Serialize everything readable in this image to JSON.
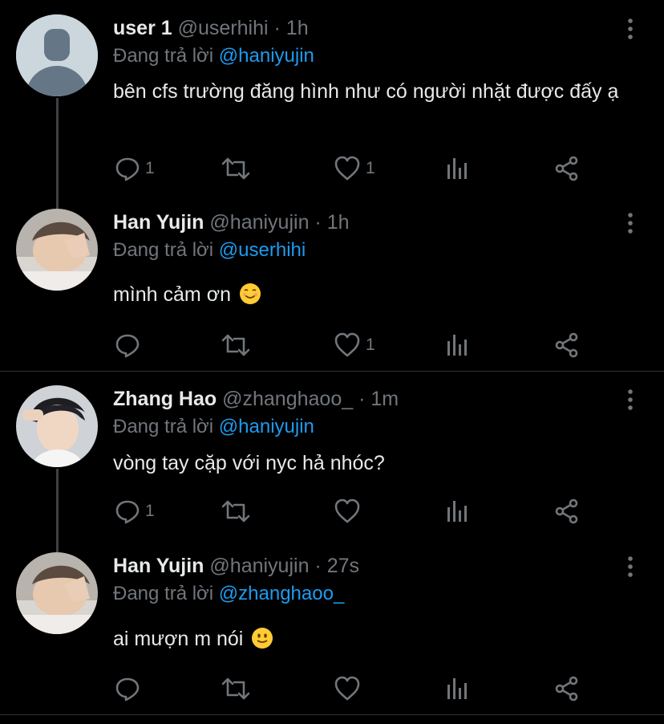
{
  "tweets": [
    {
      "name": "user 1",
      "handle": "@userhihi",
      "time": "· 1h",
      "reply_prefix": "Đang trả lời",
      "reply_to": "@haniyujin",
      "text": "bên cfs trường đăng hình như có người nhặt được đấy ạ",
      "emoji": "",
      "reply_count": "1",
      "retweet_count": "",
      "like_count": "1",
      "avatar": "default-avatar"
    },
    {
      "name": "Han Yujin",
      "handle": "@haniyujin",
      "time": "· 1h",
      "reply_prefix": "Đang trả lời",
      "reply_to": "@userhihi",
      "text": "mình cảm ơn",
      "emoji": "☺️",
      "reply_count": "",
      "retweet_count": "",
      "like_count": "1",
      "avatar": "photo-avatar"
    },
    {
      "name": "Zhang Hao",
      "handle": "@zhanghaoo_",
      "time": "· 1m",
      "reply_prefix": "Đang trả lời",
      "reply_to": "@haniyujin",
      "text": "vòng tay cặp với nyc hả nhóc?",
      "emoji": "",
      "reply_count": "1",
      "retweet_count": "",
      "like_count": "",
      "avatar": "photo-avatar"
    },
    {
      "name": "Han Yujin",
      "handle": "@haniyujin",
      "time": "· 27s",
      "reply_prefix": "Đang trả lời",
      "reply_to": "@zhanghaoo_",
      "text": "ai mượn m nói",
      "emoji": "🙂",
      "reply_count": "",
      "retweet_count": "",
      "like_count": "",
      "avatar": "photo-avatar"
    }
  ],
  "colors": {
    "background": "#000000",
    "text": "#e7e9ea",
    "muted": "#71767b",
    "link": "#1d9bf0",
    "thread": "#3e4144"
  },
  "icons": [
    "reply-icon",
    "retweet-icon",
    "like-icon",
    "views-icon",
    "share-icon",
    "more-icon"
  ]
}
